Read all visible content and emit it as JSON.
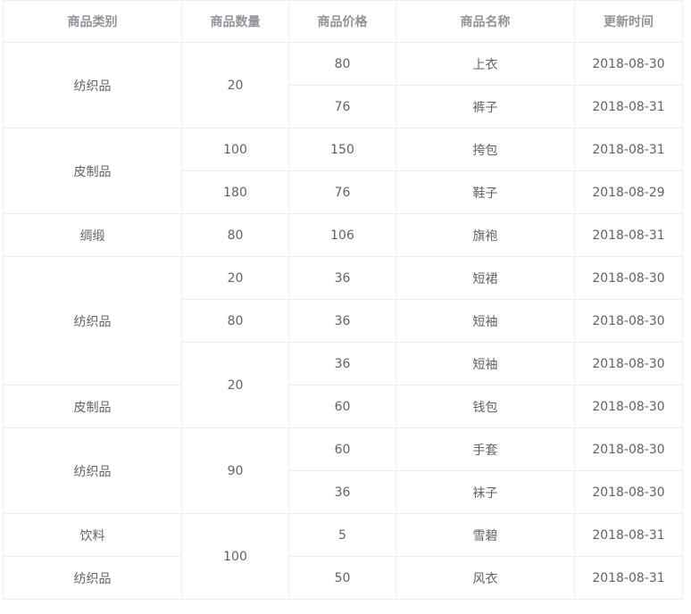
{
  "headers": [
    "商品类别",
    "商品数量",
    "商品价格",
    "商品名称",
    "更新时间"
  ],
  "rows": [
    {
      "category": "纺织品",
      "quantity": "20",
      "price": "80",
      "name": "上衣",
      "date": "2018-08-30"
    },
    {
      "price": "76",
      "name": "裤子",
      "date": "2018-08-31"
    },
    {
      "category": "皮制品",
      "quantity": "100",
      "price": "150",
      "name": "挎包",
      "date": "2018-08-31"
    },
    {
      "quantity": "180",
      "price": "76",
      "name": "鞋子",
      "date": "2018-08-29"
    },
    {
      "category": "绸缎",
      "quantity": "80",
      "price": "106",
      "name": "旗袍",
      "date": "2018-08-31"
    },
    {
      "category": "纺织品",
      "quantity": "20",
      "price": "36",
      "name": "短裙",
      "date": "2018-08-30"
    },
    {
      "quantity": "80",
      "price": "36",
      "name": "短袖",
      "date": "2018-08-30"
    },
    {
      "quantity": "20",
      "price": "36",
      "name": "短袖",
      "date": "2018-08-30"
    },
    {
      "category": "皮制品",
      "price": "60",
      "name": "钱包",
      "date": "2018-08-30"
    },
    {
      "category": "纺织品",
      "quantity": "90",
      "price": "60",
      "name": "手套",
      "date": "2018-08-30"
    },
    {
      "price": "36",
      "name": "袜子",
      "date": "2018-08-30"
    },
    {
      "category": "饮料",
      "quantity": "100",
      "price": "5",
      "name": "雪碧",
      "date": "2018-08-31"
    },
    {
      "category": "纺织品",
      "price": "50",
      "name": "风衣",
      "date": "2018-08-31"
    }
  ]
}
